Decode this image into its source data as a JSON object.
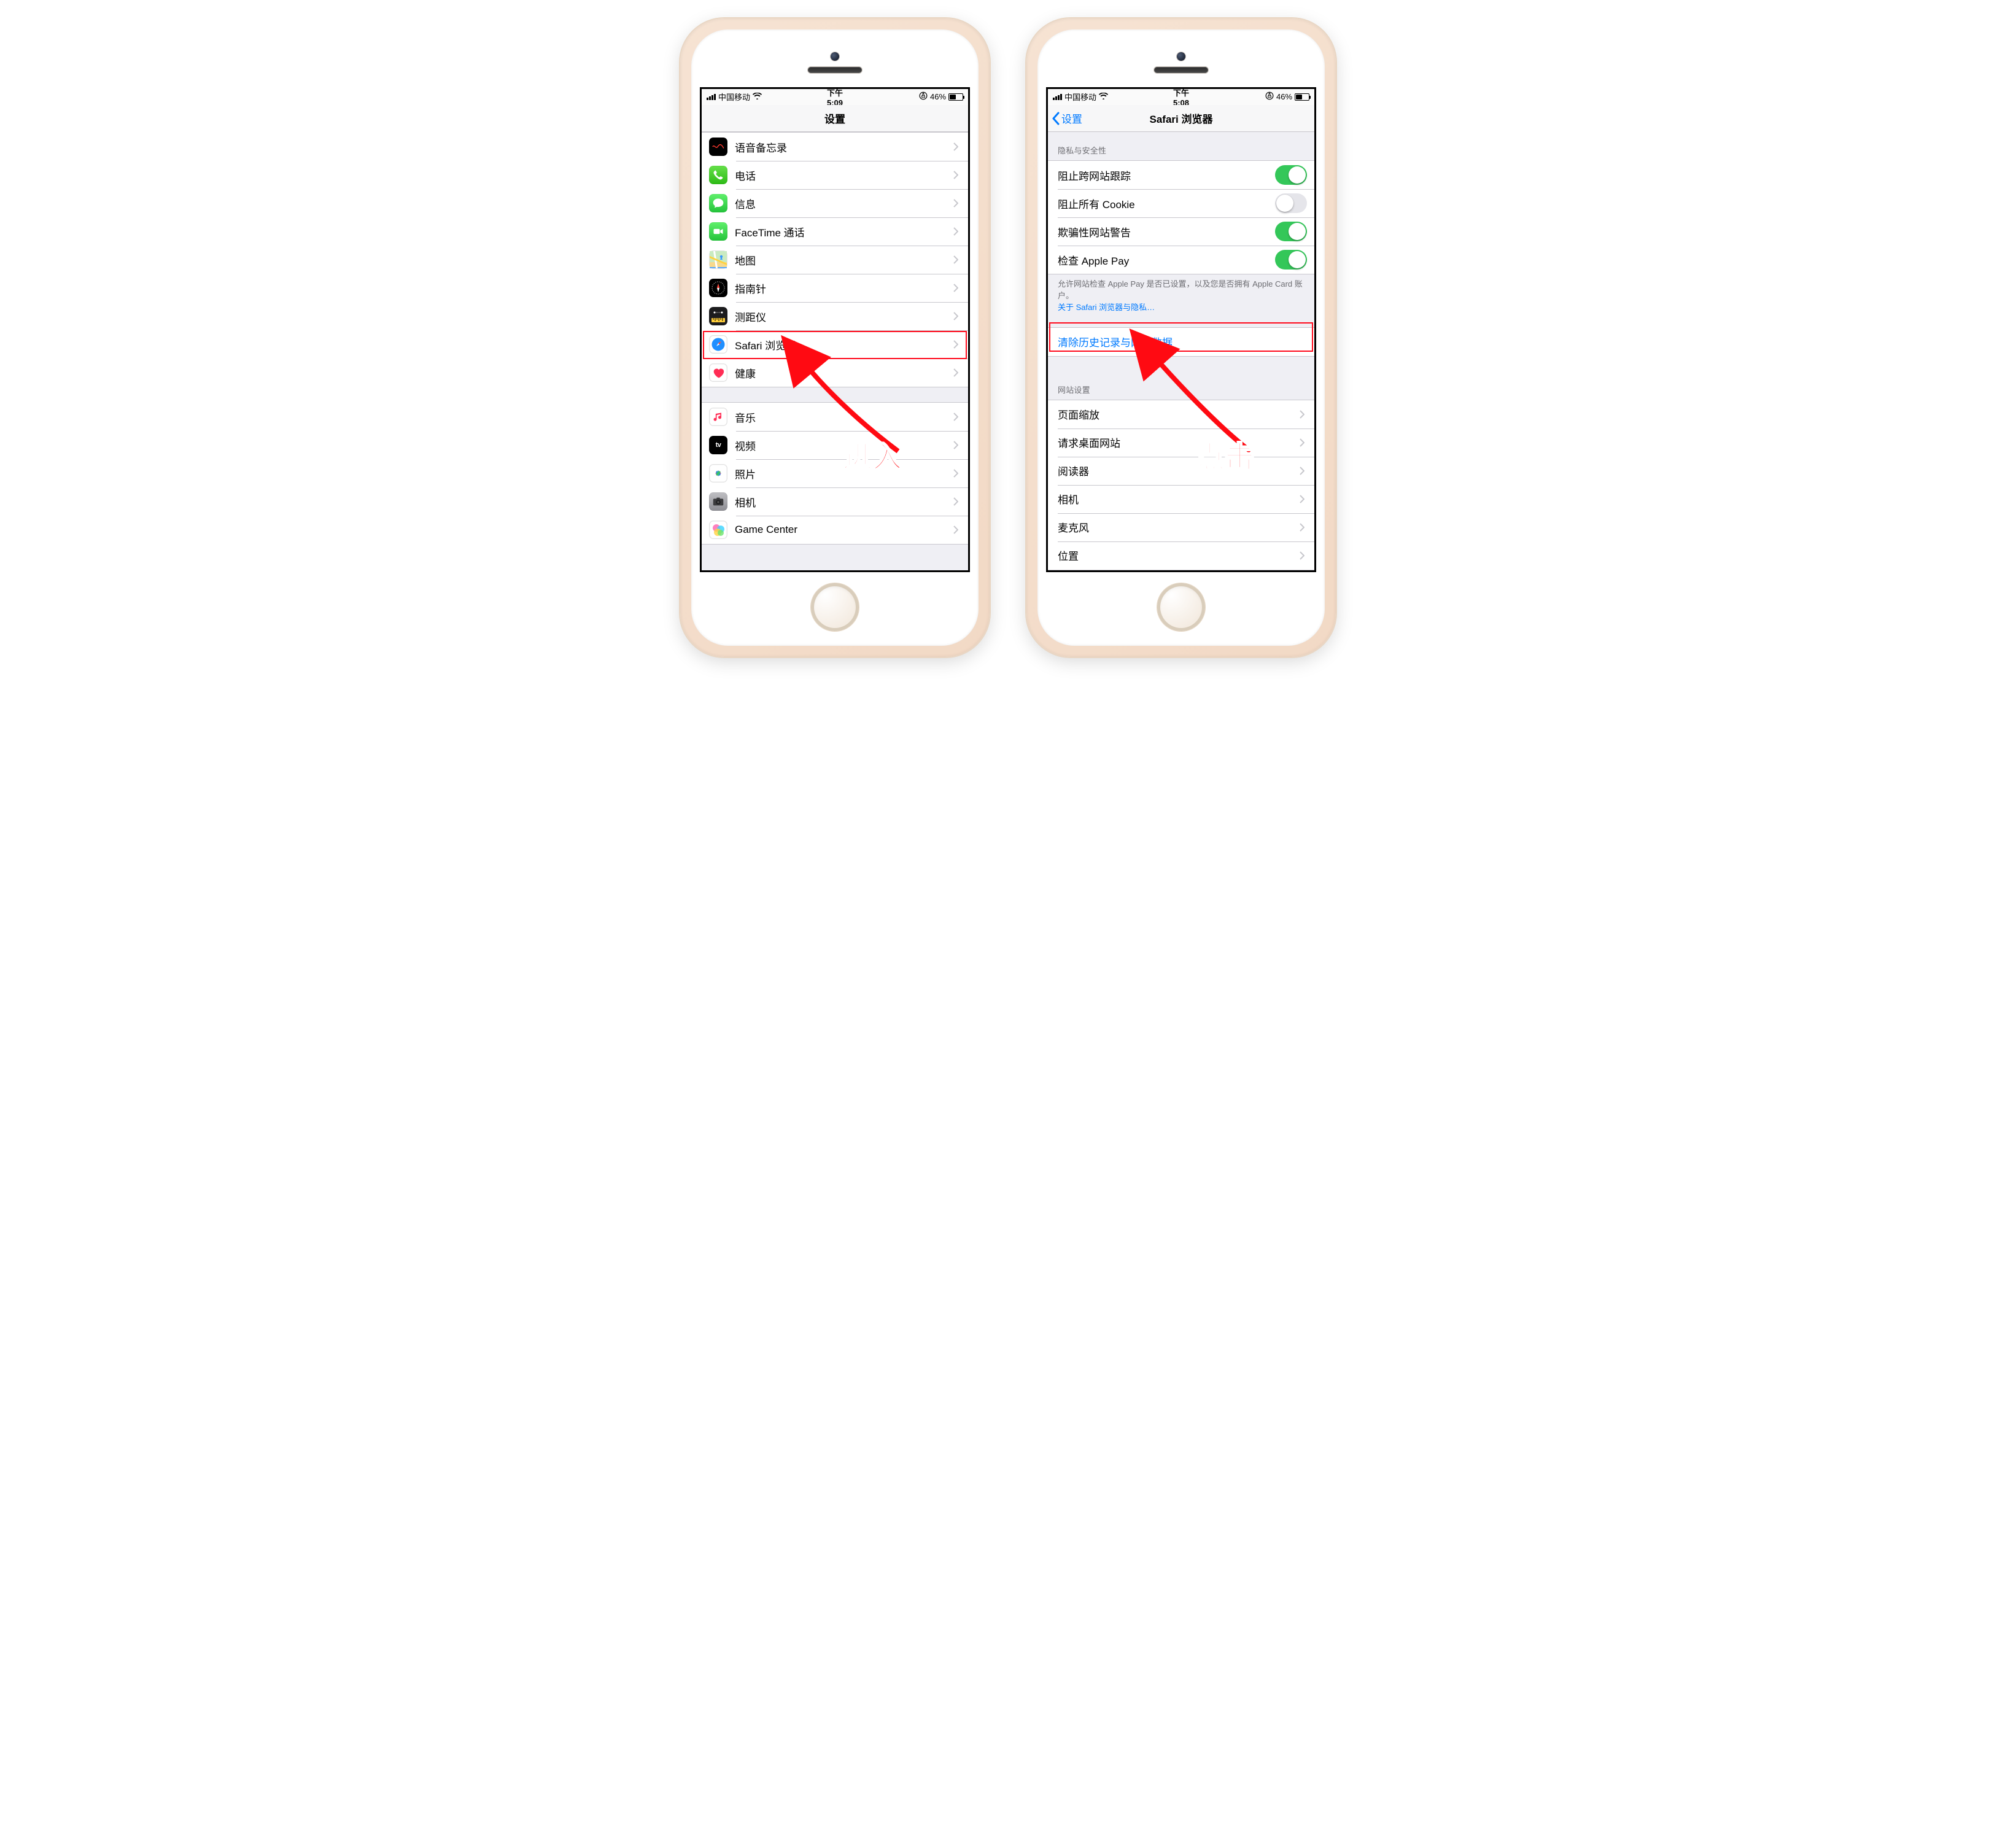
{
  "left": {
    "status": {
      "carrier": "中国移动",
      "time": "下午5:09",
      "battery": "46%"
    },
    "nav": {
      "title": "设置"
    },
    "group1": [
      {
        "label": "语音备忘录",
        "icon": "voice-memo"
      },
      {
        "label": "电话",
        "icon": "phone"
      },
      {
        "label": "信息",
        "icon": "messages"
      },
      {
        "label": "FaceTime 通话",
        "icon": "facetime"
      },
      {
        "label": "地图",
        "icon": "maps"
      },
      {
        "label": "指南针",
        "icon": "compass"
      },
      {
        "label": "测距仪",
        "icon": "measure"
      },
      {
        "label": "Safari 浏览器",
        "icon": "safari",
        "highlighted": true
      },
      {
        "label": "健康",
        "icon": "health"
      }
    ],
    "group2": [
      {
        "label": "音乐",
        "icon": "music"
      },
      {
        "label": "视频",
        "icon": "tv"
      },
      {
        "label": "照片",
        "icon": "photos"
      },
      {
        "label": "相机",
        "icon": "camera"
      },
      {
        "label": "Game Center",
        "icon": "gamecenter"
      }
    ],
    "annotation": "进入"
  },
  "right": {
    "status": {
      "carrier": "中国移动",
      "time": "下午5:08",
      "battery": "46%"
    },
    "nav": {
      "back": "设置",
      "title": "Safari 浏览器"
    },
    "privacy_header": "隐私与安全性",
    "privacy_rows": [
      {
        "label": "阻止跨网站跟踪",
        "control": "toggle",
        "on": true
      },
      {
        "label": "阻止所有 Cookie",
        "control": "toggle",
        "on": false
      },
      {
        "label": "欺骗性网站警告",
        "control": "toggle",
        "on": true
      },
      {
        "label": "检查 Apple Pay",
        "control": "toggle",
        "on": true
      }
    ],
    "privacy_footer": "允许网站检查 Apple Pay 是否已设置，以及您是否拥有 Apple Card 账户。",
    "privacy_footer_link": "关于 Safari 浏览器与隐私…",
    "clear_label": "清除历史记录与网站数据",
    "site_header": "网站设置",
    "site_rows": [
      {
        "label": "页面缩放"
      },
      {
        "label": "请求桌面网站"
      },
      {
        "label": "阅读器"
      },
      {
        "label": "相机"
      },
      {
        "label": "麦克风"
      },
      {
        "label": "位置"
      }
    ],
    "annotation": "点击"
  }
}
